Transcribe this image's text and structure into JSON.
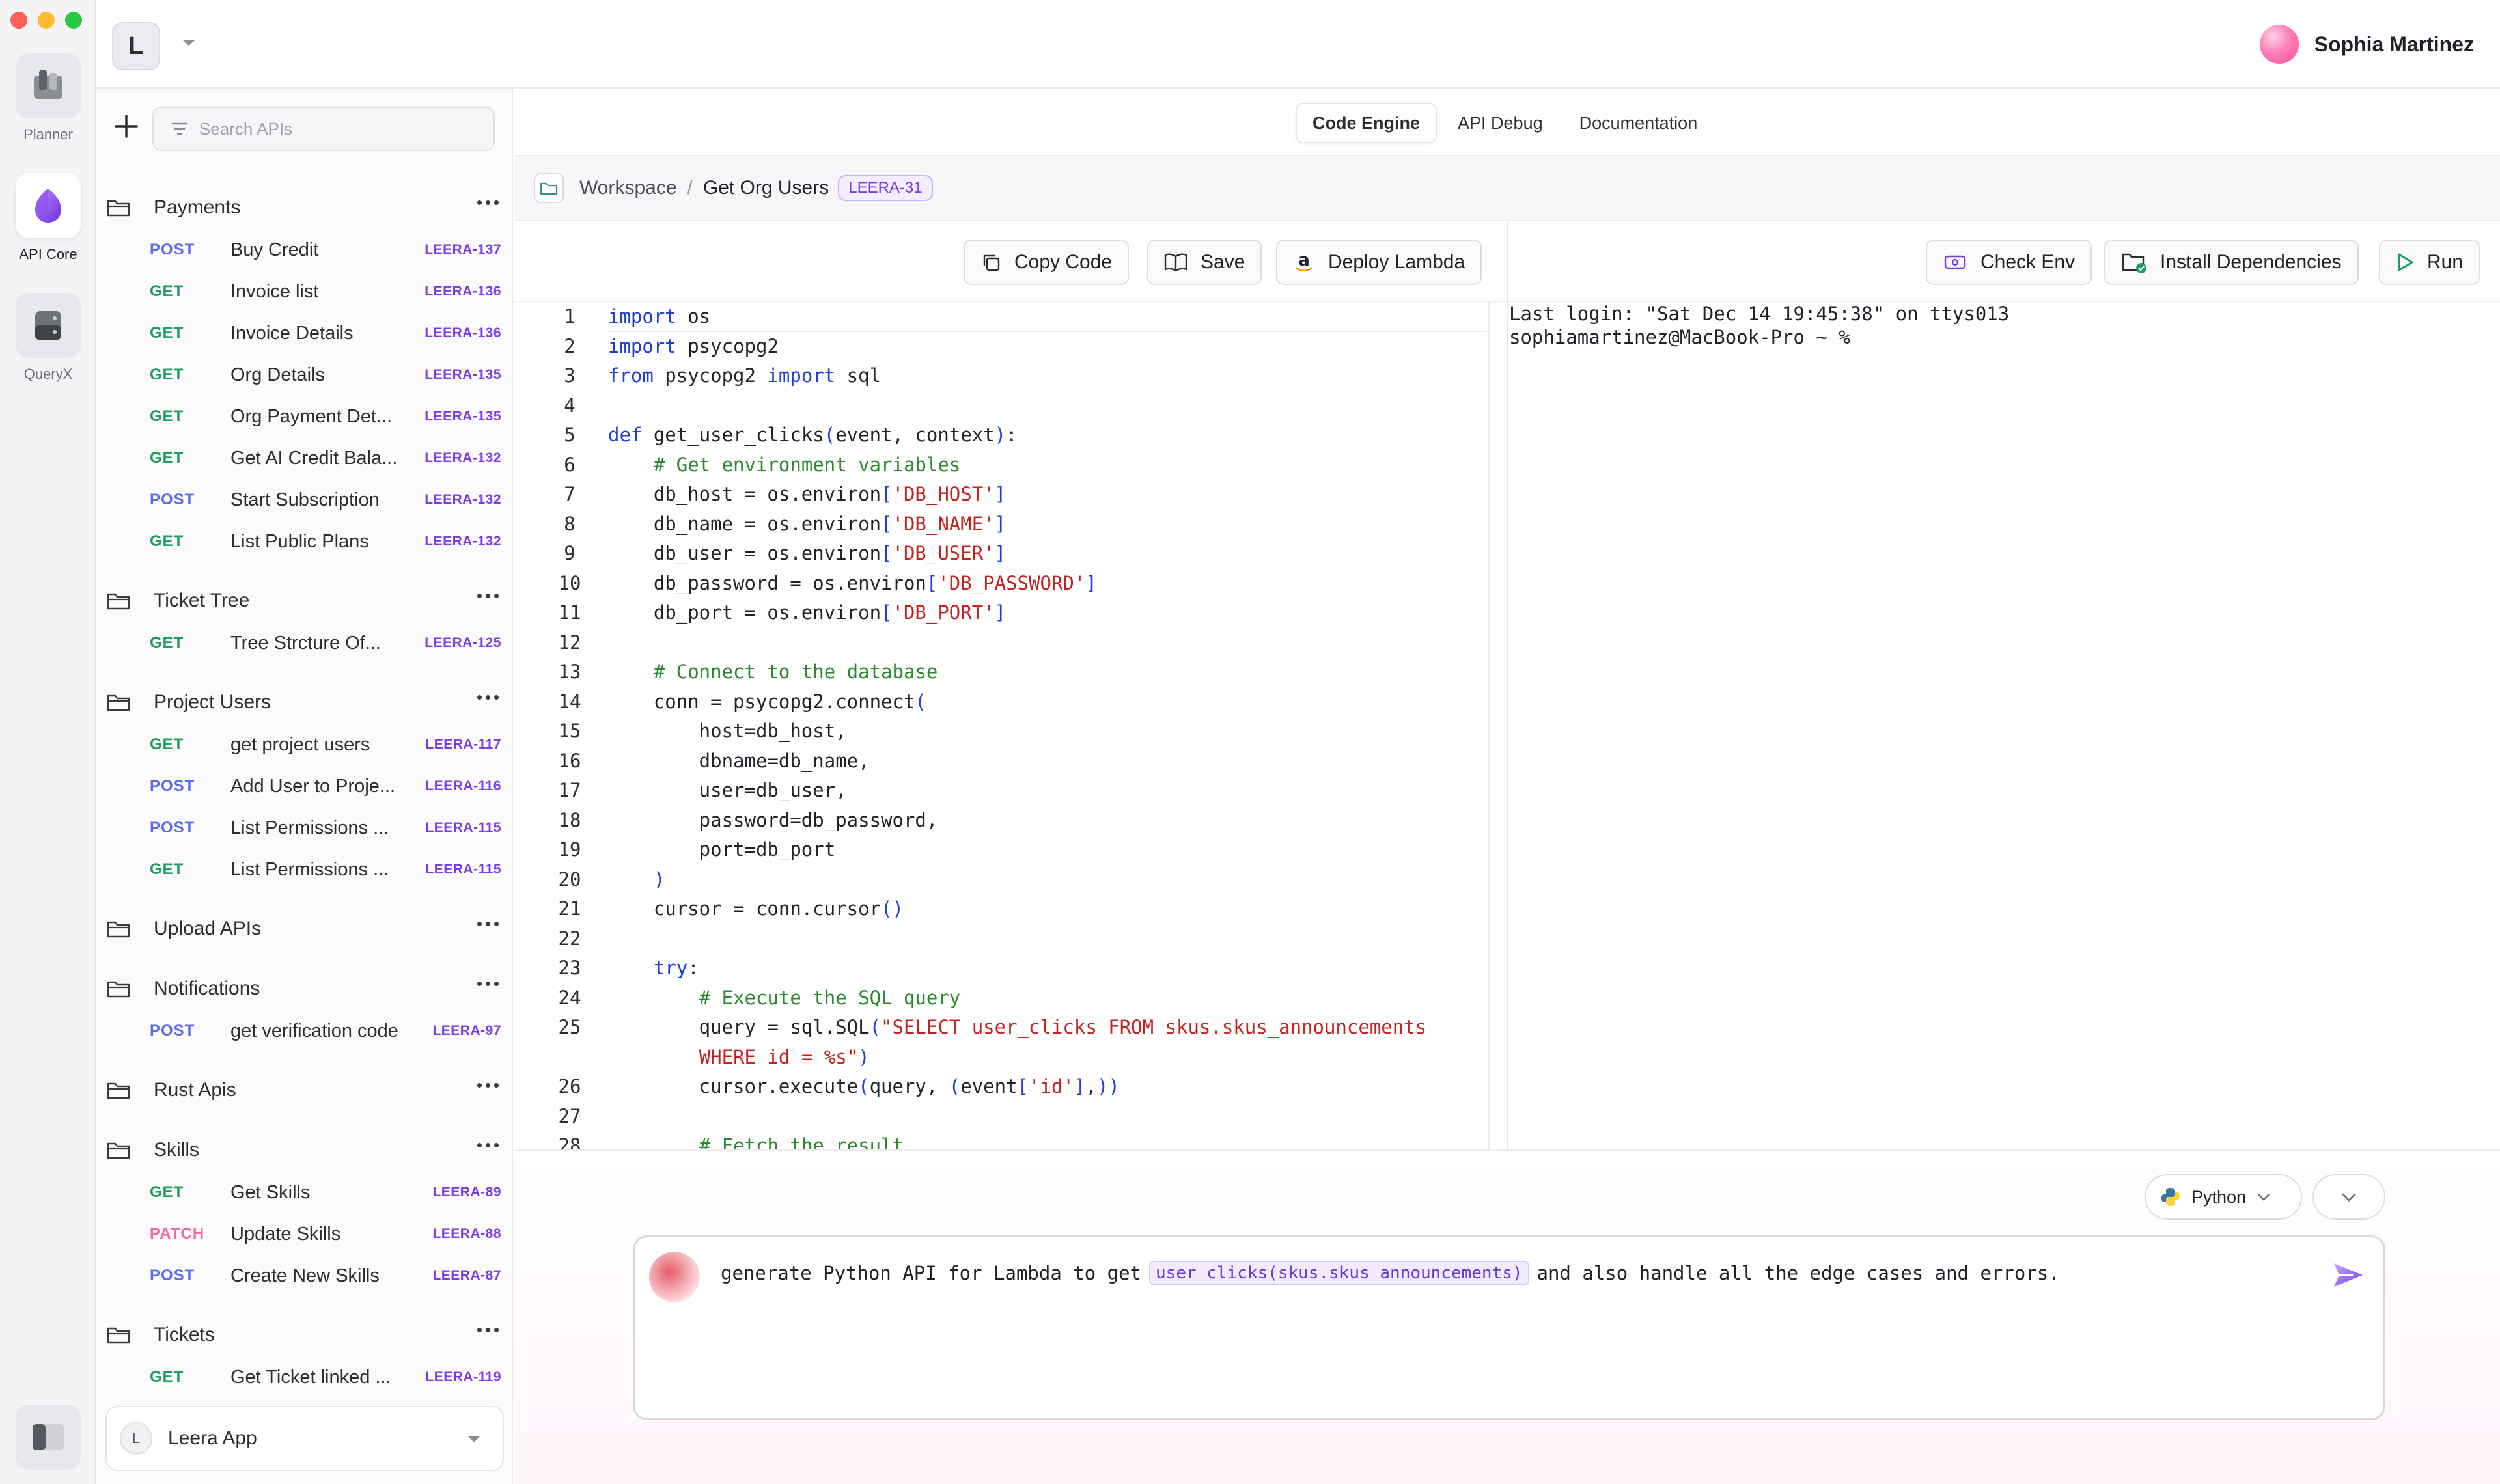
{
  "rail": {
    "apps": [
      {
        "label": "Planner",
        "icon": "planner-icon"
      },
      {
        "label": "API Core",
        "icon": "api-core-icon",
        "active": true
      },
      {
        "label": "QueryX",
        "icon": "database-icon"
      }
    ]
  },
  "topbar": {
    "workspace_letter": "L",
    "user_name": "Sophia Martinez"
  },
  "sidebar": {
    "search_placeholder": "Search APIs",
    "groups": [
      {
        "name": "Payments",
        "items": [
          {
            "method": "POST",
            "name": "Buy Credit",
            "ticket": "LEERA-137"
          },
          {
            "method": "GET",
            "name": "Invoice list",
            "ticket": "LEERA-136"
          },
          {
            "method": "GET",
            "name": "Invoice Details",
            "ticket": "LEERA-136"
          },
          {
            "method": "GET",
            "name": "Org Details",
            "ticket": "LEERA-135"
          },
          {
            "method": "GET",
            "name": "Org Payment Det...",
            "ticket": "LEERA-135"
          },
          {
            "method": "GET",
            "name": "Get AI Credit Bala...",
            "ticket": "LEERA-132"
          },
          {
            "method": "POST",
            "name": "Start Subscription",
            "ticket": "LEERA-132"
          },
          {
            "method": "GET",
            "name": "List Public Plans",
            "ticket": "LEERA-132"
          }
        ]
      },
      {
        "name": "Ticket Tree",
        "items": [
          {
            "method": "GET",
            "name": "Tree Strcture Of...",
            "ticket": "LEERA-125"
          }
        ]
      },
      {
        "name": "Project Users",
        "items": [
          {
            "method": "GET",
            "name": "get project users",
            "ticket": "LEERA-117"
          },
          {
            "method": "POST",
            "name": "Add User to Proje...",
            "ticket": "LEERA-116"
          },
          {
            "method": "POST",
            "name": "List Permissions ...",
            "ticket": "LEERA-115"
          },
          {
            "method": "GET",
            "name": "List Permissions ...",
            "ticket": "LEERA-115"
          }
        ]
      },
      {
        "name": "Upload APIs",
        "items": []
      },
      {
        "name": "Notifications",
        "items": [
          {
            "method": "POST",
            "name": "get verification code",
            "ticket": "LEERA-97"
          }
        ]
      },
      {
        "name": "Rust Apis",
        "items": []
      },
      {
        "name": "Skills",
        "items": [
          {
            "method": "GET",
            "name": "Get Skills",
            "ticket": "LEERA-89"
          },
          {
            "method": "PATCH",
            "name": "Update Skills",
            "ticket": "LEERA-88"
          },
          {
            "method": "POST",
            "name": "Create New Skills",
            "ticket": "LEERA-87"
          }
        ]
      },
      {
        "name": "Tickets",
        "items": [
          {
            "method": "GET",
            "name": "Get Ticket linked ...",
            "ticket": "LEERA-119"
          }
        ]
      }
    ],
    "app_switcher": {
      "letter": "L",
      "name": "Leera App"
    }
  },
  "tabs": [
    {
      "label": "Code Engine",
      "active": true
    },
    {
      "label": "API Debug",
      "active": false
    },
    {
      "label": "Documentation",
      "active": false
    }
  ],
  "breadcrumb": {
    "root": "Workspace",
    "separator": "/",
    "current": "Get Org Users",
    "tag": "LEERA-31"
  },
  "toolbar": {
    "copy_code": "Copy Code",
    "save": "Save",
    "deploy_lambda": "Deploy Lambda",
    "check_env": "Check Env",
    "install_deps": "Install Dependencies",
    "run": "Run"
  },
  "code_lines": [
    {
      "n": "1",
      "tokens": [
        [
          "kw",
          "import"
        ],
        [
          "",
          " os"
        ]
      ]
    },
    {
      "n": "2",
      "tokens": [
        [
          "kw",
          "import"
        ],
        [
          "",
          " psycopg2"
        ]
      ]
    },
    {
      "n": "3",
      "tokens": [
        [
          "kw",
          "from"
        ],
        [
          "",
          " psycopg2 "
        ],
        [
          "kw",
          "import"
        ],
        [
          "",
          " sql"
        ]
      ]
    },
    {
      "n": "4",
      "tokens": []
    },
    {
      "n": "5",
      "tokens": [
        [
          "kw",
          "def"
        ],
        [
          "",
          " get_user_clicks"
        ],
        [
          "pr",
          "("
        ],
        [
          "",
          "event, context"
        ],
        [
          "pr",
          ")"
        ],
        [
          "",
          ":"
        ]
      ]
    },
    {
      "n": "6",
      "tokens": [
        [
          "",
          "    "
        ],
        [
          "cm",
          "# Get environment variables"
        ]
      ]
    },
    {
      "n": "7",
      "tokens": [
        [
          "",
          "    db_host = os.environ"
        ],
        [
          "pr",
          "["
        ],
        [
          "str",
          "'DB_HOST'"
        ],
        [
          "pr",
          "]"
        ]
      ]
    },
    {
      "n": "8",
      "tokens": [
        [
          "",
          "    db_name = os.environ"
        ],
        [
          "pr",
          "["
        ],
        [
          "str",
          "'DB_NAME'"
        ],
        [
          "pr",
          "]"
        ]
      ]
    },
    {
      "n": "9",
      "tokens": [
        [
          "",
          "    db_user = os.environ"
        ],
        [
          "pr",
          "["
        ],
        [
          "str",
          "'DB_USER'"
        ],
        [
          "pr",
          "]"
        ]
      ]
    },
    {
      "n": "10",
      "tokens": [
        [
          "",
          "    db_password = os.environ"
        ],
        [
          "pr",
          "["
        ],
        [
          "str",
          "'DB_PASSWORD'"
        ],
        [
          "pr",
          "]"
        ]
      ]
    },
    {
      "n": "11",
      "tokens": [
        [
          "",
          "    db_port = os.environ"
        ],
        [
          "pr",
          "["
        ],
        [
          "str",
          "'DB_PORT'"
        ],
        [
          "pr",
          "]"
        ]
      ]
    },
    {
      "n": "12",
      "tokens": []
    },
    {
      "n": "13",
      "tokens": [
        [
          "",
          "    "
        ],
        [
          "cm",
          "# Connect to the database"
        ]
      ]
    },
    {
      "n": "14",
      "tokens": [
        [
          "",
          "    conn = psycopg2.connect"
        ],
        [
          "pr",
          "("
        ]
      ]
    },
    {
      "n": "15",
      "tokens": [
        [
          "",
          "        host=db_host,"
        ]
      ]
    },
    {
      "n": "16",
      "tokens": [
        [
          "",
          "        dbname=db_name,"
        ]
      ]
    },
    {
      "n": "17",
      "tokens": [
        [
          "",
          "        user=db_user,"
        ]
      ]
    },
    {
      "n": "18",
      "tokens": [
        [
          "",
          "        password=db_password,"
        ]
      ]
    },
    {
      "n": "19",
      "tokens": [
        [
          "",
          "        port=db_port"
        ]
      ]
    },
    {
      "n": "20",
      "tokens": [
        [
          "",
          "    "
        ],
        [
          "pr",
          ")"
        ]
      ]
    },
    {
      "n": "21",
      "tokens": [
        [
          "",
          "    cursor = conn.cursor"
        ],
        [
          "pr",
          "()"
        ]
      ]
    },
    {
      "n": "22",
      "tokens": []
    },
    {
      "n": "23",
      "tokens": [
        [
          "",
          "    "
        ],
        [
          "kw",
          "try"
        ],
        [
          "",
          ":"
        ]
      ]
    },
    {
      "n": "24",
      "tokens": [
        [
          "",
          "        "
        ],
        [
          "cm",
          "# Execute the SQL query"
        ]
      ]
    },
    {
      "n": "25",
      "tokens": [
        [
          "",
          "        query = sql.SQL"
        ],
        [
          "pr",
          "("
        ],
        [
          "str",
          "\"SELECT user_clicks FROM skus.skus_announcements"
        ]
      ]
    },
    {
      "n": "",
      "tokens": [
        [
          "",
          "        "
        ],
        [
          "str",
          "WHERE id = %s\""
        ],
        [
          "pr",
          ")"
        ]
      ]
    },
    {
      "n": "26",
      "tokens": [
        [
          "",
          "        cursor.execute"
        ],
        [
          "pr",
          "("
        ],
        [
          "",
          "query, "
        ],
        [
          "pr",
          "("
        ],
        [
          "",
          "event"
        ],
        [
          "pr",
          "["
        ],
        [
          "str",
          "'id'"
        ],
        [
          "pr",
          "]"
        ],
        [
          "",
          ","
        ],
        [
          "pr",
          "))"
        ]
      ]
    },
    {
      "n": "27",
      "tokens": []
    },
    {
      "n": "28",
      "tokens": [
        [
          "",
          "        "
        ],
        [
          "cm",
          "# Fetch the result"
        ]
      ]
    }
  ],
  "terminal": {
    "lines": [
      "Last login: \"Sat Dec 14 19:45:38\" on ttys013",
      "sophiamartinez@MacBook-Pro ~ %"
    ]
  },
  "prompt": {
    "language": "Python",
    "text_before": "generate Python API for Lambda to get",
    "chip": "user_clicks(skus.skus_announcements)",
    "text_after": "and also handle all the edge cases and errors."
  },
  "colors": {
    "accent_purple": "#7a3ce6",
    "get": "#1f9d62",
    "post": "#5b6bf0",
    "patch": "#f06aa6"
  }
}
